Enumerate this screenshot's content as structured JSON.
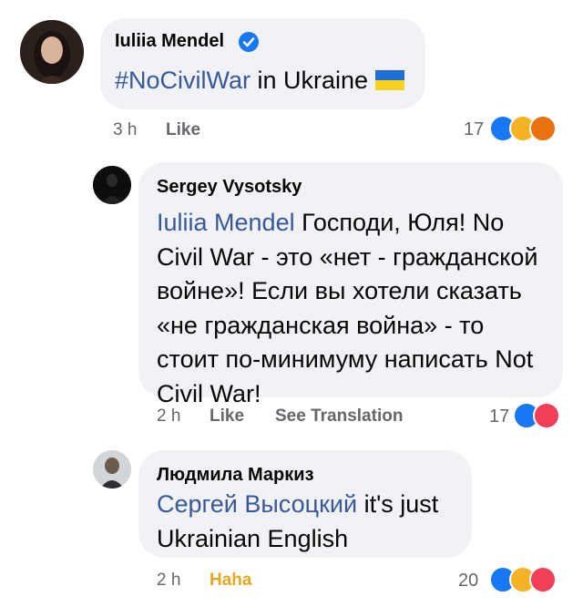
{
  "comments": [
    {
      "author": "Iuliia Mendel",
      "verified": true,
      "hashtag": "#NoCivilWar",
      "text": " in Ukraine ",
      "flag": "ukraine-flag",
      "time": "3 h",
      "like_label": "Like",
      "reaction_count": "17",
      "reactions": [
        "like",
        "haha",
        "angry"
      ]
    },
    {
      "author": "Sergey Vysotsky",
      "mention": "Iuliia Mendel",
      "text": " Господи, Юля! No Civil War - это «нет - гражданской войне»! Если вы хотели сказать «не гражданская война» - то стоит по-минимуму написать Not Civil War!",
      "time": "2 h",
      "like_label": "Like",
      "translate_label": "See Translation",
      "reaction_count": "17",
      "reactions": [
        "like",
        "love"
      ]
    },
    {
      "author": "Людмила Маркиз",
      "mention": "Сергей Высоцкий",
      "text": " it's just Ukrainian English",
      "time": "2 h",
      "like_label": "Haha",
      "reaction_count": "20",
      "reactions": [
        "like",
        "haha",
        "love"
      ]
    }
  ],
  "colors": {
    "bubble": "#f0f2f5",
    "link": "#385898",
    "meta": "#65676b",
    "like": "#1877f2",
    "haha": "#f7b125",
    "love": "#f33e58",
    "angry": "#e9710f"
  }
}
